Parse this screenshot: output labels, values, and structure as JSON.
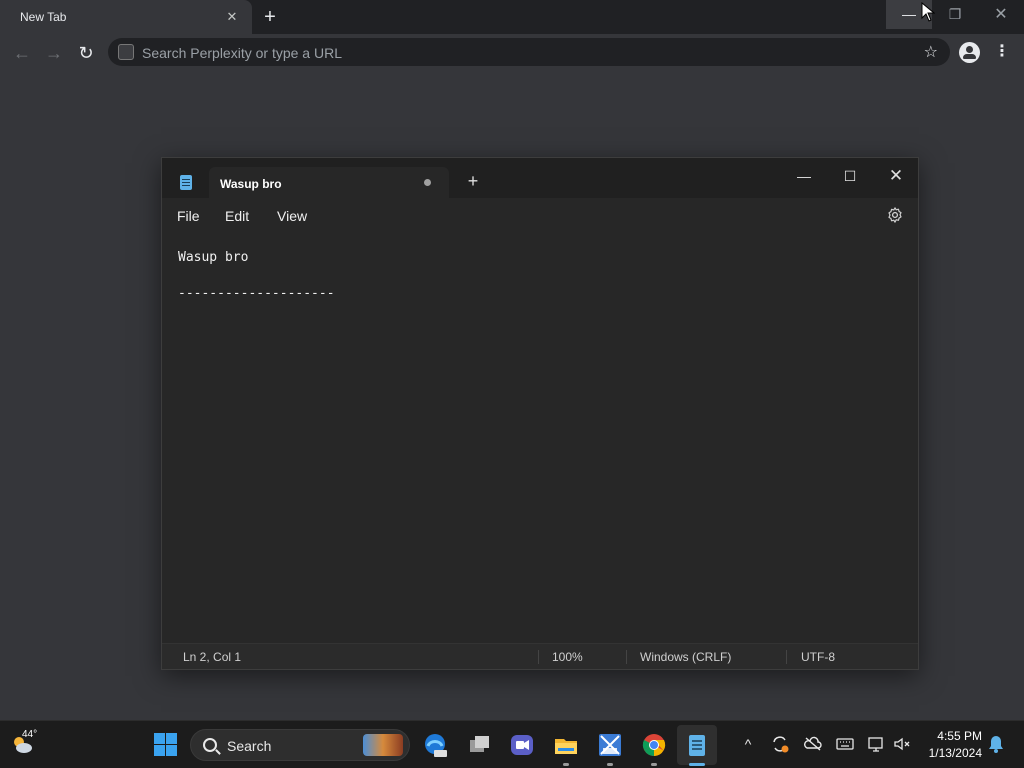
{
  "browser": {
    "tab_title": "New Tab",
    "tab_close": "✕",
    "new_tab": "+",
    "omnibox_placeholder": "Search Perplexity or type a URL",
    "window_controls": {
      "minimize": "—",
      "maximize": "❐",
      "close": "✕"
    },
    "nav": {
      "back": "←",
      "forward": "→",
      "reload": "↻",
      "star": "☆",
      "menu": "⋮"
    }
  },
  "notepad": {
    "tab_title": "Wasup bro",
    "new_tab": "+",
    "window_controls": {
      "minimize": "—",
      "maximize": "☐",
      "close": "✕"
    },
    "menu": {
      "file": "File",
      "edit": "Edit",
      "view": "View"
    },
    "lines": [
      "Wasup bro",
      "--------------------"
    ],
    "status": {
      "position": "Ln 2, Col 1",
      "zoom": "100%",
      "line_ending": "Windows (CRLF)",
      "encoding": "UTF-8"
    }
  },
  "taskbar": {
    "weather_temp": "44°",
    "search_label": "Search",
    "apps": [
      "task-view-icon",
      "meet-icon",
      "file-explorer-icon",
      "game-icon",
      "chrome-icon",
      "notepad-icon"
    ],
    "tray": {
      "chevron": "^"
    },
    "clock": {
      "time": "4:55 PM",
      "date": "1/13/2024"
    }
  },
  "colors": {
    "accent": "#5fb2e8",
    "chrome_bg": "#35363a",
    "notepad_bg": "#272727"
  }
}
